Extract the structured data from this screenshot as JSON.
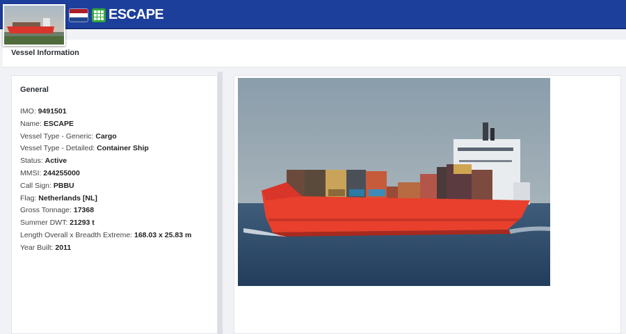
{
  "vessel": {
    "name": "ESCAPE",
    "flag_icon": "netherlands-flag-icon",
    "type_icon": "container-grid-icon",
    "type_icon_color": "#2fa83a"
  },
  "colors": {
    "header": "#1d3f9c",
    "hull": "#e8402c"
  },
  "page_title": "Vessel Information",
  "general": {
    "title": "General",
    "rows": [
      {
        "label": "IMO: ",
        "value": "9491501"
      },
      {
        "label": "Name: ",
        "value": "ESCAPE"
      },
      {
        "label": "Vessel Type - Generic: ",
        "value": "Cargo"
      },
      {
        "label": "Vessel Type - Detailed: ",
        "value": "Container Ship"
      },
      {
        "label": "Status: ",
        "value": "Active"
      },
      {
        "label": "MMSI: ",
        "value": "244255000"
      },
      {
        "label": "Call Sign: ",
        "value": "PBBU"
      },
      {
        "label": "Flag: ",
        "value": "Netherlands [NL]"
      },
      {
        "label": "Gross Tonnage: ",
        "value": "17368"
      },
      {
        "label": "Summer DWT: ",
        "value": "21293 t"
      },
      {
        "label": "Length Overall x Breadth Extreme: ",
        "value": "168.03 x 25.83 m"
      },
      {
        "label": "Year Built: ",
        "value": "2011"
      }
    ]
  }
}
